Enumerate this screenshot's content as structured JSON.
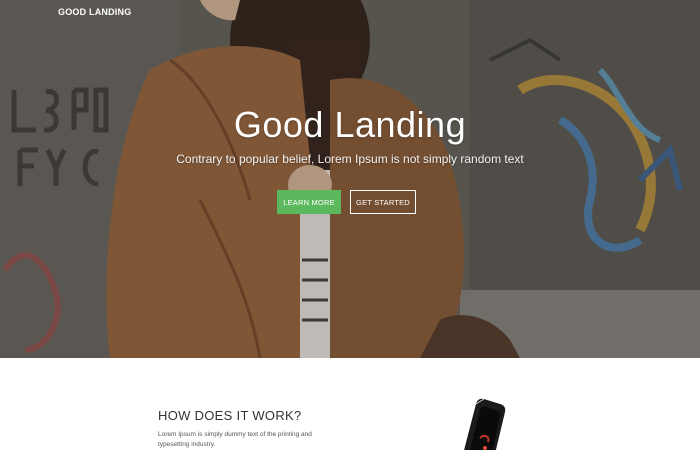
{
  "header": {
    "brand": "GOOD LANDING"
  },
  "hero": {
    "title": "Good Landing",
    "subtitle": "Contrary to popular belief, Lorem Ipsum is not simply random text",
    "learn_more_label": "LEARN MORE",
    "get_started_label": "GET STARTED"
  },
  "how_it_works": {
    "title": "HOW DOES IT WORK?",
    "text": "Lorem Ipsum is simply dummy text of the printing and typesetting industry."
  },
  "colors": {
    "accent": "#5cb85c",
    "hero_text": "#ffffff",
    "body_text": "#333333"
  },
  "icons": {
    "phone_image": "smartphone-image",
    "hero_image": "woman-leather-jacket-photo"
  }
}
